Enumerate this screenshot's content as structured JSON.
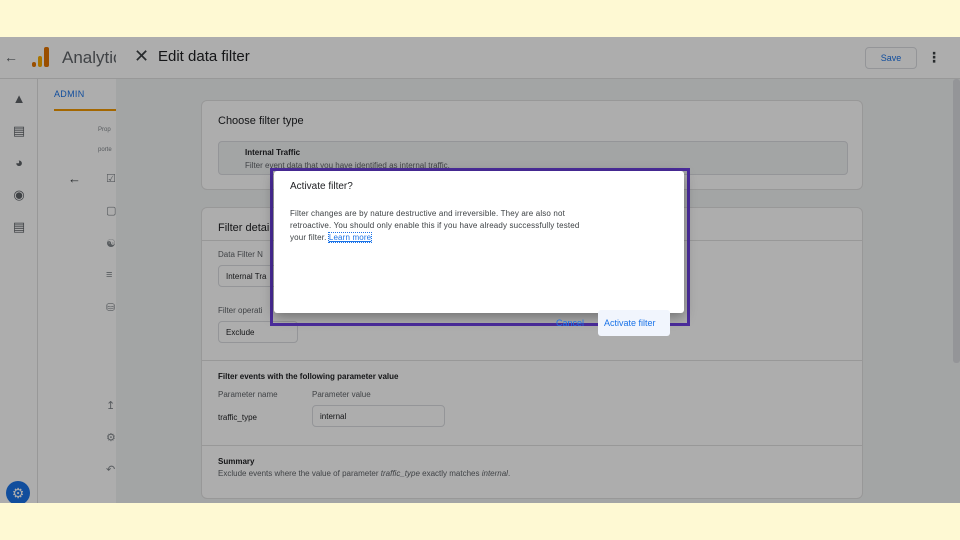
{
  "app": {
    "product_name": "Analytics",
    "admin_tab": "ADMIN",
    "faint_property": "Prop",
    "faint_account": "porte"
  },
  "editor": {
    "title": "Edit data filter",
    "save_label": "Save"
  },
  "filter_type": {
    "heading": "Choose filter type",
    "selected_title": "Internal Traffic",
    "selected_desc": "Filter event data that you have identified as internal traffic."
  },
  "filter_details": {
    "heading": "Filter detai",
    "name_label": "Data Filter N",
    "name_value": "Internal Tra",
    "operation_label": "Filter operati",
    "operation_value": "Exclude",
    "params_heading": "Filter events with the following parameter value",
    "param_name_label": "Parameter name",
    "param_value_label": "Parameter value",
    "param_name": "traffic_type",
    "param_value": "internal",
    "summary_heading": "Summary",
    "summary_pre": "Exclude events where the value of parameter ",
    "summary_param": "traffic_type",
    "summary_mid": " exactly matches ",
    "summary_value": "internal",
    "summary_post": "."
  },
  "dialog": {
    "title": "Activate filter?",
    "body_line1": "Filter changes are by nature destructive and irreversible. They are also not",
    "body_line2": "retroactive. You should only enable this if you have already successfully tested",
    "body_line3": "your filter. ",
    "learn_more": "Learn more",
    "cancel_label": "Cancel",
    "activate_label": "Activate filter"
  },
  "colors": {
    "accent": "#1a73e8",
    "highlight_border": "#4b2c9c",
    "page_background": "#fef9d3"
  }
}
